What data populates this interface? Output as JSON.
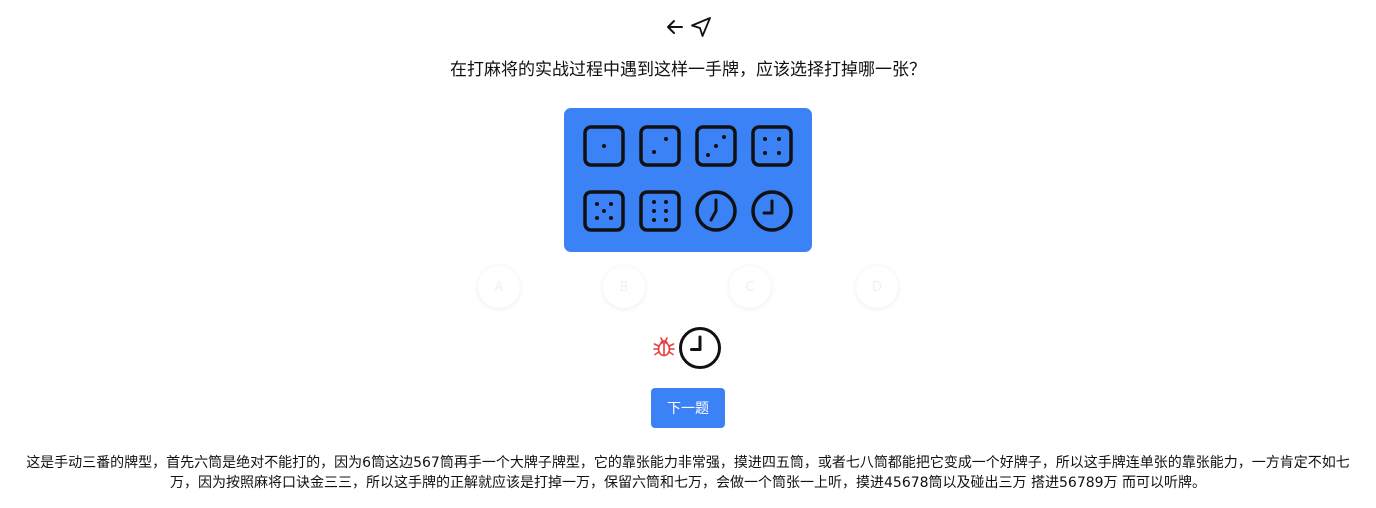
{
  "nav": {
    "back_icon": "arrow-left-icon",
    "share_icon": "send-icon"
  },
  "question": {
    "text": "在打麻将的实战过程中遇到这样一手牌，应该选择打掉哪一张？"
  },
  "hand": {
    "panel_color": "#3b82f6",
    "tiles": [
      {
        "name": "one-dot-tile-icon",
        "pips": 1
      },
      {
        "name": "two-dot-tile-icon",
        "pips": 2
      },
      {
        "name": "three-dot-tile-icon",
        "pips": 3
      },
      {
        "name": "four-dot-tile-icon",
        "pips": 4
      },
      {
        "name": "five-dot-tile-icon",
        "pips": 5
      },
      {
        "name": "six-dot-tile-icon",
        "pips": 6
      },
      {
        "name": "clock-tile-icon",
        "pips": 0
      },
      {
        "name": "clock-tile-icon",
        "pips": 0
      }
    ]
  },
  "options": [
    {
      "label": "A"
    },
    {
      "label": "B"
    },
    {
      "label": "C"
    },
    {
      "label": "D"
    }
  ],
  "answer": {
    "bug_icon": "bug-icon",
    "bug_color": "#e53e3e",
    "tile_icon": "clock-icon"
  },
  "next_button": {
    "label": "下一题",
    "color": "#3b82f6"
  },
  "explanation": {
    "text": "这是手动三番的牌型，首先六筒是绝对不能打的，因为6筒这边567筒再手一个大牌子牌型，它的靠张能力非常强，摸进四五筒，或者七八筒都能把它变成一个好牌子，所以这手牌连单张的靠张能力，一方肯定不如七万，因为按照麻将口诀金三三，所以这手牌的正解就应该是打掉一万，保留六筒和七万，会做一个筒张一上听，摸进45678筒以及碰出三万 搭进56789万 而可以听牌。"
  }
}
